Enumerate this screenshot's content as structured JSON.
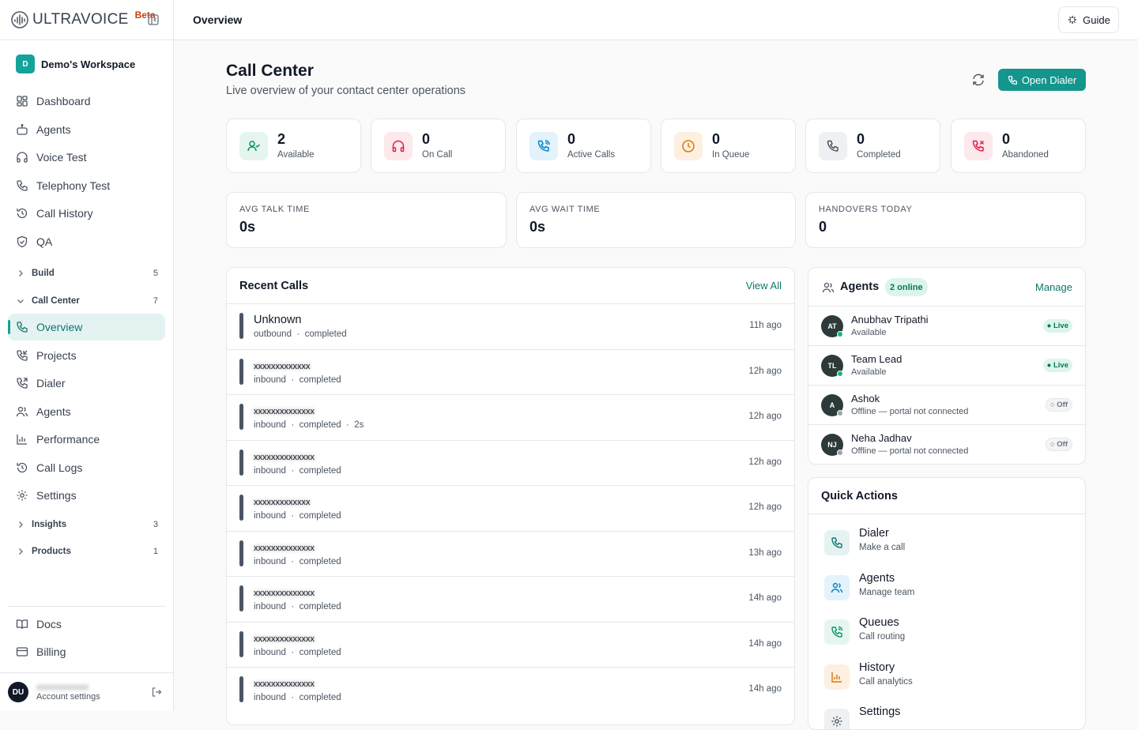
{
  "brand": {
    "name": "ULTRAVOICE",
    "beta": "Beta"
  },
  "workspace": {
    "initial": "D",
    "name": "Demo's Workspace"
  },
  "sidebar": {
    "items": [
      {
        "label": "Dashboard",
        "icon": "dashboard-icon"
      },
      {
        "label": "Agents",
        "icon": "bot-icon"
      },
      {
        "label": "Voice Test",
        "icon": "headphones-icon"
      },
      {
        "label": "Telephony Test",
        "icon": "phone-icon"
      },
      {
        "label": "Call History",
        "icon": "history-icon"
      },
      {
        "label": "QA",
        "icon": "shield-check-icon"
      }
    ],
    "groups": {
      "build": {
        "label": "Build",
        "count": "5"
      },
      "call_center": {
        "label": "Call Center",
        "count": "7"
      },
      "insights": {
        "label": "Insights",
        "count": "3"
      },
      "products": {
        "label": "Products",
        "count": "1"
      }
    },
    "call_center_items": [
      {
        "label": "Overview",
        "icon": "phone-icon",
        "active": true
      },
      {
        "label": "Projects",
        "icon": "phone-incoming-icon"
      },
      {
        "label": "Dialer",
        "icon": "phone-outgoing-icon"
      },
      {
        "label": "Agents",
        "icon": "users-icon"
      },
      {
        "label": "Performance",
        "icon": "bar-chart-icon"
      },
      {
        "label": "Call Logs",
        "icon": "history-icon"
      },
      {
        "label": "Settings",
        "icon": "gear-icon"
      }
    ],
    "footer": [
      {
        "label": "Docs",
        "icon": "book-icon"
      },
      {
        "label": "Billing",
        "icon": "credit-card-icon"
      }
    ],
    "user": {
      "initials": "DU",
      "name_hidden": "xxxxxxxxxxxx",
      "account_label": "Account settings"
    }
  },
  "topbar": {
    "title": "Overview",
    "guide_label": "Guide"
  },
  "page": {
    "title": "Call Center",
    "subtitle": "Live overview of your contact center operations",
    "open_dialer": "Open Dialer"
  },
  "stats": [
    {
      "value": "2",
      "label": "Available",
      "icon": "user-check-icon",
      "color": "#059669",
      "bg": "#e6f6ef"
    },
    {
      "value": "0",
      "label": "On Call",
      "icon": "headphones-icon",
      "color": "#e11d48",
      "bg": "#fde8ec"
    },
    {
      "value": "0",
      "label": "Active Calls",
      "icon": "phone-call-icon",
      "color": "#0284c7",
      "bg": "#e3f2fb"
    },
    {
      "value": "0",
      "label": "In Queue",
      "icon": "clock-icon",
      "color": "#d97706",
      "bg": "#fdf0e0"
    },
    {
      "value": "0",
      "label": "Completed",
      "icon": "phone-icon",
      "color": "#4b5563",
      "bg": "#eef0f2"
    },
    {
      "value": "0",
      "label": "Abandoned",
      "icon": "phone-missed-icon",
      "color": "#e11d48",
      "bg": "#fde8ec"
    }
  ],
  "metrics": [
    {
      "label": "AVG TALK TIME",
      "value": "0s"
    },
    {
      "label": "AVG WAIT TIME",
      "value": "0s"
    },
    {
      "label": "HANDOVERS TODAY",
      "value": "0"
    }
  ],
  "recent_calls": {
    "title": "Recent Calls",
    "view_all": "View All",
    "rows": [
      {
        "name": "Unknown",
        "blurred": false,
        "direction": "outbound",
        "status": "completed",
        "duration": "",
        "time": "11h ago"
      },
      {
        "name": "xxxxxxxxxxxxx",
        "blurred": true,
        "direction": "inbound",
        "status": "completed",
        "duration": "",
        "time": "12h ago"
      },
      {
        "name": "xxxxxxxxxxxxxx",
        "blurred": true,
        "direction": "inbound",
        "status": "completed",
        "duration": "2s",
        "time": "12h ago"
      },
      {
        "name": "xxxxxxxxxxxxxx",
        "blurred": true,
        "direction": "inbound",
        "status": "completed",
        "duration": "",
        "time": "12h ago"
      },
      {
        "name": "xxxxxxxxxxxxx",
        "blurred": true,
        "direction": "inbound",
        "status": "completed",
        "duration": "",
        "time": "12h ago"
      },
      {
        "name": "xxxxxxxxxxxxxx",
        "blurred": true,
        "direction": "inbound",
        "status": "completed",
        "duration": "",
        "time": "13h ago"
      },
      {
        "name": "xxxxxxxxxxxxxx",
        "blurred": true,
        "direction": "inbound",
        "status": "completed",
        "duration": "",
        "time": "14h ago"
      },
      {
        "name": "xxxxxxxxxxxxxx",
        "blurred": true,
        "direction": "inbound",
        "status": "completed",
        "duration": "",
        "time": "14h ago"
      },
      {
        "name": "xxxxxxxxxxxxxx",
        "blurred": true,
        "direction": "inbound",
        "status": "completed",
        "duration": "",
        "time": "14h ago"
      }
    ]
  },
  "agents_panel": {
    "title": "Agents",
    "online_badge": "2 online",
    "manage": "Manage",
    "agents": [
      {
        "initials": "AT",
        "name": "Anubhav Tripathi",
        "status": "Available",
        "online": true,
        "pill": "● Live"
      },
      {
        "initials": "TL",
        "name": "Team Lead",
        "status": "Available",
        "online": true,
        "pill": "● Live"
      },
      {
        "initials": "A",
        "name": "Ashok",
        "status": "Offline — portal not connected",
        "online": false,
        "pill": "○ Off"
      },
      {
        "initials": "NJ",
        "name": "Neha Jadhav",
        "status": "Offline — portal not connected",
        "online": false,
        "pill": "○ Off"
      }
    ]
  },
  "quick_actions": {
    "title": "Quick Actions",
    "items": [
      {
        "name": "Dialer",
        "desc": "Make a call",
        "icon": "phone-icon",
        "color": "#0f766e",
        "bg": "#e4f3f2"
      },
      {
        "name": "Agents",
        "desc": "Manage team",
        "icon": "users-icon",
        "color": "#0284c7",
        "bg": "#e3f2fb"
      },
      {
        "name": "Queues",
        "desc": "Call routing",
        "icon": "phone-call-icon",
        "color": "#059669",
        "bg": "#e6f6ef"
      },
      {
        "name": "History",
        "desc": "Call analytics",
        "icon": "bar-chart-icon",
        "color": "#d97706",
        "bg": "#fdf0e0"
      },
      {
        "name": "Settings",
        "desc": "",
        "icon": "gear-icon",
        "color": "#4b5563",
        "bg": "#eef0f2"
      }
    ]
  }
}
